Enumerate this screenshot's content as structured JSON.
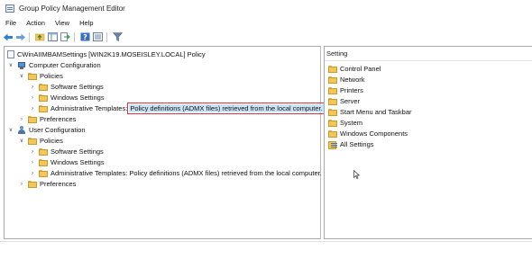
{
  "window": {
    "title": "Group Policy Management Editor",
    "accent": "#d9363e"
  },
  "menu": {
    "items": [
      "File",
      "Action",
      "View",
      "Help"
    ]
  },
  "toolbar": {
    "icons": [
      "back-arrow-icon",
      "forward-arrow-icon",
      "up-folder-icon",
      "show-hide-tree-icon",
      "export-list-icon",
      "help-icon",
      "properties-icon",
      "filter-icon"
    ]
  },
  "tree": {
    "root": "CWinAIIMBAMSettings [WIN2K19.MOSEISLEY.LOCAL] Policy",
    "computer": {
      "label": "Computer Configuration",
      "policies": "Policies",
      "software": "Software Settings",
      "windows": "Windows Settings",
      "admin": "Administrative Templates:",
      "admin_detail": "Policy definitions (ADMX files) retrieved from the local computer.",
      "preferences": "Preferences"
    },
    "user": {
      "label": "User Configuration",
      "policies": "Policies",
      "software": "Software Settings",
      "windows": "Windows Settings",
      "admin": "Administrative Templates: Policy definitions (ADMX files) retrieved from the local computer.",
      "preferences": "Preferences"
    }
  },
  "list": {
    "header": "Setting",
    "items": [
      "Control Panel",
      "Network",
      "Printers",
      "Server",
      "Start Menu and Taskbar",
      "System",
      "Windows Components",
      "All Settings"
    ]
  }
}
